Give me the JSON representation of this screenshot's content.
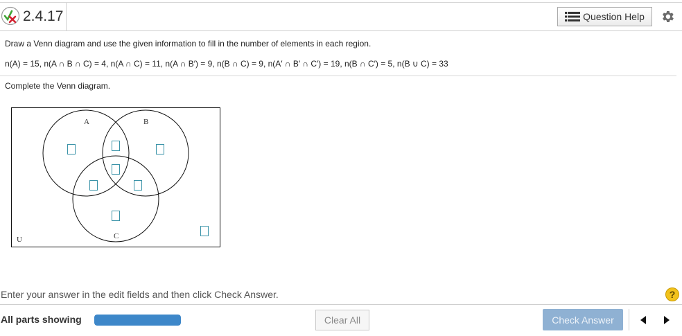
{
  "header": {
    "question_number": "2.4.17",
    "status_icon": "partially-correct-icon",
    "help_label": "Question Help",
    "help_icon": "list-icon",
    "settings_icon": "gear-icon"
  },
  "question": {
    "instruction": "Draw a Venn diagram and use the given information to fill in the number of elements in each region.",
    "given": "n(A) = 15, n(A ∩ B ∩ C) = 4, n(A ∩ C) = 11, n(A ∩ B′) = 9, n(B ∩ C) = 9, n(A′ ∩ B′ ∩ C′) = 19, n(B ∩ C′) = 5, n(B ∪ C) = 33",
    "prompt": "Complete the Venn diagram."
  },
  "venn": {
    "label_a": "A",
    "label_b": "B",
    "label_c": "C",
    "label_u": "U",
    "regions": {
      "a_only": "",
      "a_and_b_only": "",
      "b_only": "",
      "a_b_c": "",
      "a_and_c_only": "",
      "b_and_c_only": "",
      "c_only": "",
      "outside": ""
    }
  },
  "footer": {
    "enter_text": "Enter your answer in the edit fields and then click Check Answer.",
    "help_symbol": "?",
    "parts_label": "All parts showing",
    "progress_fraction": 1.0,
    "clear_label": "Clear All",
    "check_label": "Check Answer"
  },
  "colors": {
    "accent_blue": "#3d87c9",
    "check_button": "#8fb1d3",
    "input_border": "#3a93a8",
    "help_yellow": "#f2c21b"
  }
}
